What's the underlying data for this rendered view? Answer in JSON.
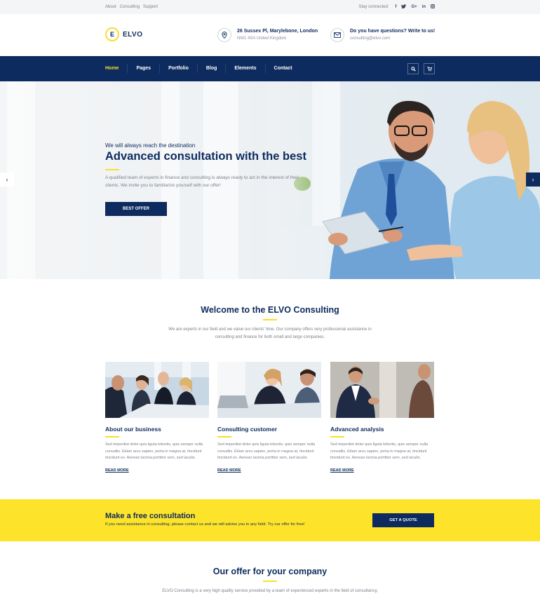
{
  "topbar": {
    "links": [
      "About",
      "Consulting",
      "Support"
    ],
    "stay_connected": "Stay connected:",
    "social_icons": [
      "facebook-icon",
      "twitter-icon",
      "google-plus-icon",
      "linkedin-icon",
      "instagram-icon"
    ]
  },
  "header": {
    "logo_letter": "E",
    "logo_text": "ELVO",
    "address": {
      "title": "26 Sussex Pl, Marylebone, London",
      "sub": "NW1 4SA United Kingdom",
      "icon": "location-pin-icon"
    },
    "questions": {
      "title": "Do you have questions? Write to us!",
      "sub": "consulting@elvo.com",
      "icon": "envelope-icon"
    }
  },
  "nav": {
    "items": [
      "Home",
      "Pages",
      "Portfolio",
      "Blog",
      "Elements",
      "Contact"
    ],
    "active": "Home",
    "buttons": [
      "search-icon",
      "cart-icon"
    ]
  },
  "hero": {
    "subtitle": "We will always reach the destination",
    "title": "Advanced consultation with the best",
    "description": "A qualified team of experts in finance and consulting is always ready to act in the interest of their clients. We invite you to familiarize yourself with our offer!",
    "button": "BEST OFFER"
  },
  "welcome": {
    "title": "Welcome to the ELVO Consulting",
    "description": "We are experts in our field and we value our clients' time. Our company offers very professional assistance in consulting and finance for both small and large companies."
  },
  "cards": [
    {
      "title": "About our business",
      "text": "Sed imperdiet dolor quis ligula lobortis, quis semper nulla convallis. Etiam arcu sapien, porta in magna at, tincidunt tincidunt ex. Aenean lacinia porttitor sem, sed iaculis.",
      "link": "READ MORE"
    },
    {
      "title": "Consulting customer",
      "text": "Sed imperdiet dolor quis ligula lobortis, quis semper nulla convallis. Etiam arcu sapien, porta in magna at, tincidunt tincidunt ex. Aenean lacinia porttitor sem, sed iaculis.",
      "link": "READ MORE"
    },
    {
      "title": "Advanced analysis",
      "text": "Sed imperdiet dolor quis ligula lobortis, quis semper nulla convallis. Etiam arcu sapien, porta in magna at, tincidunt tincidunt ex. Aenean lacinia porttitor sem, sed iaculis.",
      "link": "READ MORE"
    }
  ],
  "cta": {
    "title": "Make a free consultation",
    "description": "If you need assistance in consulting, please contact us and we will advise you in any field. Try our offer for free!",
    "button": "GET A QUOTE"
  },
  "offer": {
    "title": "Our offer for your company",
    "description": "ELVO Consulting is a very high quality service provided by a team of experienced experts in the field of consultancy,"
  },
  "colors": {
    "navy": "#0d2b5e",
    "yellow": "#fde42a",
    "accent": "#f9de2b",
    "muted": "#7a7f8a"
  }
}
